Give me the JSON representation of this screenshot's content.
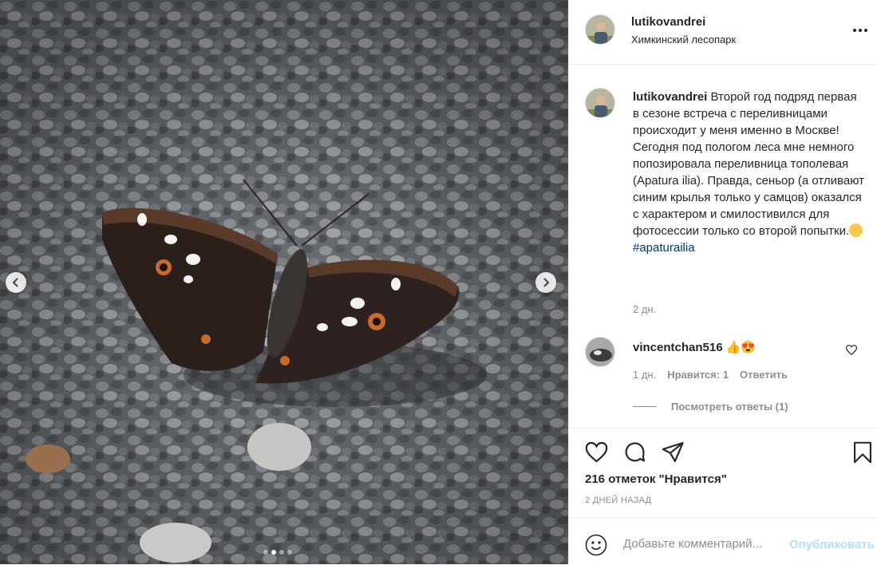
{
  "post": {
    "username": "lutikovandrei",
    "location": "Химкинский лесопарк",
    "caption_text": "Второй год подряд первая в сезоне встреча с переливницами происходит у меня именно в Москве! Сегодня под пологом леса мне немного попозировала переливница тополевая (Apatura ilia). Правда, сеньор (а отливают синим крылья только у самцов) оказался с характером и смилостивился для фотосессии только со второй попытки.",
    "hashtag": "#apaturailia",
    "caption_time": "2 дн."
  },
  "comment": {
    "username": "vincentchan516",
    "emojis": "👍😍",
    "time": "1 дн.",
    "likes": "Нравится: 1",
    "reply": "Ответить",
    "view_replies": "Посмотреть ответы (1)"
  },
  "actions": {
    "likes_count": "216 отметок \"Нравится\"",
    "date": "2 ДНЕЙ НАЗАД"
  },
  "comment_box": {
    "placeholder": "Добавьте комментарий...",
    "publish": "Опубликовать"
  },
  "carousel": {
    "current": 2,
    "total": 4
  },
  "icons": [
    "more-options-icon",
    "chevron-left-icon",
    "chevron-right-icon",
    "heart-icon",
    "comment-icon",
    "share-icon",
    "bookmark-icon",
    "emoji-icon"
  ],
  "colors": {
    "link": "#00376b",
    "publish_disabled": "#b2dffc",
    "muted": "#8e8e8e"
  }
}
